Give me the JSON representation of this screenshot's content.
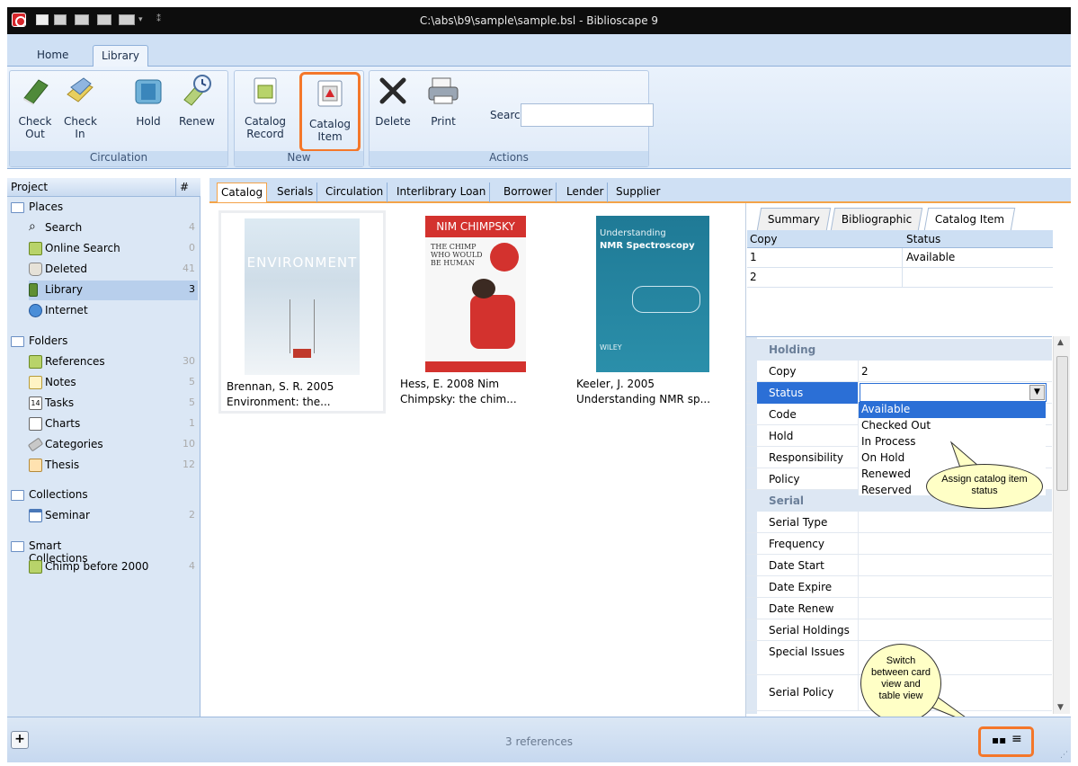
{
  "window": {
    "title": "C:\\abs\\b9\\sample\\sample.bsl - Biblioscape 9"
  },
  "ribbon_tabs": [
    "Home",
    "Library"
  ],
  "ribbon": {
    "circulation": {
      "label": "Circulation",
      "buttons": [
        "Check Out",
        "Check In",
        "Hold",
        "Renew"
      ]
    },
    "new": {
      "label": "New",
      "buttons": [
        "Catalog Record",
        "Catalog Item"
      ]
    },
    "actions": {
      "label": "Actions",
      "delete": "Delete",
      "print": "Print",
      "search_label": "Search",
      "search_value": ""
    }
  },
  "left_panel": {
    "header": "Project",
    "header_col": "#",
    "places": {
      "label": "Places",
      "items": [
        {
          "label": "Search",
          "count": "4"
        },
        {
          "label": "Online Search",
          "count": "0"
        },
        {
          "label": "Deleted",
          "count": "41"
        },
        {
          "label": "Library",
          "count": "3"
        },
        {
          "label": "Internet",
          "count": ""
        }
      ]
    },
    "folders": {
      "label": "Folders",
      "items": [
        {
          "label": "References",
          "count": "30"
        },
        {
          "label": "Notes",
          "count": "5"
        },
        {
          "label": "Tasks",
          "count": "5"
        },
        {
          "label": "Charts",
          "count": "1"
        },
        {
          "label": "Categories",
          "count": "10"
        },
        {
          "label": "Thesis",
          "count": "12"
        }
      ]
    },
    "collections": {
      "label": "Collections",
      "items": [
        {
          "label": "Seminar",
          "count": "2"
        }
      ]
    },
    "smart_collections": {
      "label": "Smart Collections",
      "items": [
        {
          "label": "Chimp before 2000",
          "count": "4"
        }
      ]
    }
  },
  "content_tabs": [
    "Catalog",
    "Serials",
    "Circulation",
    "Interlibrary Loan",
    "Borrower",
    "Lender",
    "Supplier"
  ],
  "cards": [
    {
      "line1": "Brennan, S. R. 2005",
      "line2": "Environment: the...",
      "cover_title": "ENVIRONMENT"
    },
    {
      "line1": "Hess, E. 2008  Nim",
      "line2": "Chimpsky: the chim...",
      "cover_title": "NIM CHIMPSKY",
      "cover_sub": "THE CHIMP WHO WOULD BE HUMAN"
    },
    {
      "line1": "Keeler, J. 2005",
      "line2": "Understanding NMR sp...",
      "cover_title": "Understanding",
      "cover_sub": "NMR Spectroscopy",
      "cover_pub": "WILEY"
    }
  ],
  "right_panel": {
    "tabs": [
      "Summary",
      "Bibliographic",
      "Catalog Item"
    ],
    "copies": {
      "headers": [
        "Copy",
        "Status"
      ],
      "rows": [
        [
          "1",
          "Available"
        ],
        [
          "2",
          ""
        ]
      ]
    },
    "holding": {
      "label": "Holding",
      "rows": [
        {
          "key": "Copy",
          "value": "2"
        },
        {
          "key": "Status",
          "value": ""
        },
        {
          "key": "Code",
          "value": ""
        },
        {
          "key": "Hold",
          "value": ""
        },
        {
          "key": "Responsibility",
          "value": ""
        },
        {
          "key": "Policy",
          "value": ""
        }
      ]
    },
    "serial": {
      "label": "Serial",
      "rows": [
        {
          "key": "Serial Type",
          "value": ""
        },
        {
          "key": "Frequency",
          "value": ""
        },
        {
          "key": "Date Start",
          "value": ""
        },
        {
          "key": "Date Expire",
          "value": ""
        },
        {
          "key": "Date Renew",
          "value": ""
        },
        {
          "key": "Serial Holdings",
          "value": ""
        },
        {
          "key": "Special Issues",
          "value": ""
        },
        {
          "key": "Serial Policy",
          "value": ""
        }
      ]
    },
    "status_options": [
      "Available",
      "Checked Out",
      "In Process",
      "On Hold",
      "Renewed",
      "Reserved"
    ]
  },
  "callouts": {
    "status": "Assign catalog item status",
    "view": "Switch between card view and table view"
  },
  "statusbar": {
    "text": "3 references",
    "add_label": "+"
  },
  "colors": {
    "highlight": "#f4772a",
    "accent": "#2b6fd6",
    "ribbon": "#cfe0f4"
  }
}
